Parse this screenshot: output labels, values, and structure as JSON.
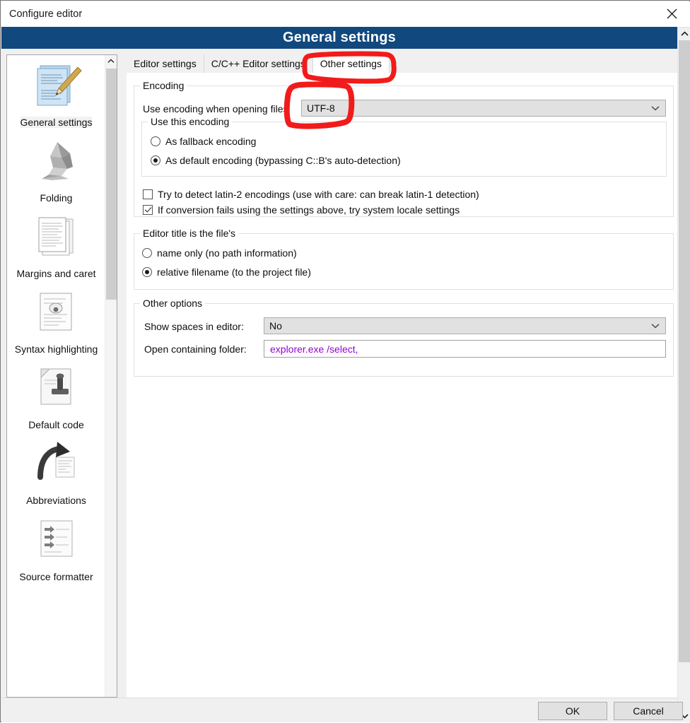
{
  "window": {
    "title": "Configure editor",
    "close_icon": "close-icon"
  },
  "header": {
    "title": "General settings",
    "background": "#11487e",
    "text_color": "#ffffff"
  },
  "sidebar": {
    "items": [
      {
        "label": "General settings",
        "icon": "document-pencil-icon",
        "selected": true
      },
      {
        "label": "Folding",
        "icon": "origami-bird-icon",
        "selected": false
      },
      {
        "label": "Margins and caret",
        "icon": "stacked-pages-icon",
        "selected": false
      },
      {
        "label": "Syntax highlighting",
        "icon": "highlighted-document-icon",
        "selected": false
      },
      {
        "label": "Default code",
        "icon": "rubber-stamp-document-icon",
        "selected": false
      },
      {
        "label": "Abbreviations",
        "icon": "arrow-document-icon",
        "selected": false
      },
      {
        "label": "Source formatter",
        "icon": "arrows-list-document-icon",
        "selected": false
      }
    ]
  },
  "tabs": [
    {
      "label": "Editor settings",
      "active": false
    },
    {
      "label": "C/C++ Editor settings",
      "active": false
    },
    {
      "label": "Other settings",
      "active": true
    }
  ],
  "encoding_group": {
    "legend": "Encoding",
    "use_encoding_label": "Use encoding when opening files",
    "encoding_value": "UTF-8",
    "inner_group": {
      "legend": "Use this encoding",
      "options": [
        {
          "label": "As fallback encoding",
          "selected": false
        },
        {
          "label": "As default encoding (bypassing C::B's auto-detection)",
          "selected": true
        }
      ]
    },
    "checkboxes": [
      {
        "label": "Try to detect latin-2 encodings (use with care: can break latin-1 detection)",
        "checked": false
      },
      {
        "label": "If conversion fails using the settings above, try system locale settings",
        "checked": true
      }
    ]
  },
  "title_group": {
    "legend": "Editor title is the file's",
    "options": [
      {
        "label": "name only (no path information)",
        "selected": false
      },
      {
        "label": "relative filename (to the project file)",
        "selected": true
      }
    ]
  },
  "other_options_group": {
    "legend": "Other options",
    "show_spaces_label": "Show spaces in editor:",
    "show_spaces_value": "No",
    "open_folder_label": "Open containing folder:",
    "open_folder_value": "explorer.exe /select,",
    "open_folder_text_color": "#9400d3"
  },
  "footer": {
    "ok_label": "OK",
    "cancel_label": "Cancel"
  },
  "annotations": {
    "color": "#f21b1b",
    "marks": [
      {
        "name": "highlight-other-settings-tab"
      },
      {
        "name": "highlight-encoding-combobox"
      }
    ]
  },
  "scrollbars": {
    "sidebar_up_icon": "chevron-up-icon",
    "outer_up_icon": "chevron-up-icon",
    "outer_down_icon": "chevron-down-icon"
  }
}
